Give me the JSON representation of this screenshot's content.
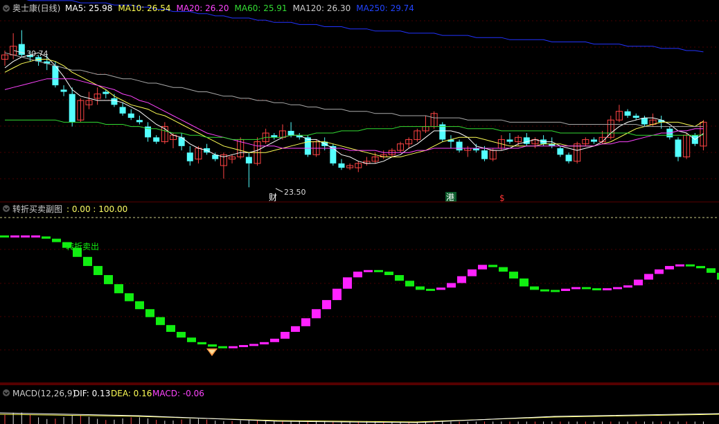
{
  "main_panel": {
    "header": {
      "stock": "奥士康(日线)",
      "ma_labels": [
        {
          "text": "MA5: 25.98",
          "color": "#ffffff"
        },
        {
          "text": "MA10: 26.54",
          "color": "#ffff55"
        },
        {
          "text": "MA20: 26.20",
          "color": "#ff44ff"
        },
        {
          "text": "MA60: 25.91",
          "color": "#33dd33"
        },
        {
          "text": "MA120: 26.30",
          "color": "#cccccc"
        },
        {
          "text": "MA250: 29.74",
          "color": "#2244ff"
        }
      ]
    },
    "high_label": "30.74",
    "low_label": "23.50",
    "markers": {
      "cai": "财",
      "gang": "港",
      "dollar": "$"
    }
  },
  "sub_panel": {
    "title": "转折买卖副图",
    "range": ": 0.00 : 100.00",
    "sell_label": "转折卖出"
  },
  "macd_panel": {
    "title": "MACD(12,26,9)",
    "dif": "DIF: 0.13",
    "dea": "DEA: 0.16",
    "macd": "MACD: -0.06"
  },
  "colors": {
    "up": "#ff4444",
    "down": "#54ffff",
    "buy": "#ff22ff",
    "sell": "#11ee11",
    "ma250": "#2233ff"
  },
  "chart_data": [
    {
      "type": "candlestick",
      "title": "奥士康(日线)",
      "ylim": [
        23.0,
        31.3
      ],
      "ohlc": [
        [
          29.4,
          29.8,
          29.1,
          29.6
        ],
        [
          29.6,
          30.6,
          29.4,
          30.0
        ],
        [
          30.1,
          30.74,
          29.5,
          29.6
        ],
        [
          29.6,
          29.8,
          29.3,
          29.5
        ],
        [
          29.5,
          29.6,
          29.1,
          29.3
        ],
        [
          29.3,
          29.6,
          28.9,
          29.2
        ],
        [
          29.1,
          29.3,
          28.1,
          28.2
        ],
        [
          28.0,
          28.2,
          27.7,
          27.9
        ],
        [
          27.8,
          28.1,
          26.3,
          26.5
        ],
        [
          26.6,
          27.6,
          26.5,
          27.5
        ],
        [
          27.3,
          27.9,
          27.1,
          27.5
        ],
        [
          27.6,
          28.1,
          27.3,
          27.8
        ],
        [
          27.9,
          28.0,
          27.6,
          27.8
        ],
        [
          27.6,
          27.8,
          27.2,
          27.3
        ],
        [
          27.2,
          27.4,
          26.8,
          26.9
        ],
        [
          26.9,
          27.1,
          26.6,
          26.7
        ],
        [
          26.6,
          26.8,
          26.4,
          26.5
        ],
        [
          26.3,
          26.5,
          25.6,
          25.8
        ],
        [
          25.8,
          25.9,
          25.5,
          25.6
        ],
        [
          25.6,
          26.5,
          25.5,
          26.3
        ],
        [
          25.7,
          26.0,
          25.3,
          25.9
        ],
        [
          25.8,
          26.0,
          25.2,
          25.4
        ],
        [
          25.1,
          25.4,
          24.5,
          24.7
        ],
        [
          24.8,
          25.4,
          24.6,
          25.3
        ],
        [
          25.3,
          25.5,
          25.0,
          25.1
        ],
        [
          25.0,
          25.1,
          24.7,
          24.8
        ],
        [
          24.5,
          25.1,
          23.9,
          25.0
        ],
        [
          24.8,
          25.0,
          24.6,
          24.9
        ],
        [
          24.9,
          25.8,
          24.8,
          25.7
        ],
        [
          24.9,
          25.1,
          23.5,
          24.6
        ],
        [
          24.6,
          25.8,
          24.5,
          25.6
        ],
        [
          25.6,
          26.2,
          25.5,
          26.0
        ],
        [
          25.9,
          26.0,
          25.7,
          25.8
        ],
        [
          25.8,
          26.4,
          25.7,
          26.1
        ],
        [
          26.1,
          26.5,
          25.8,
          25.9
        ],
        [
          25.9,
          26.0,
          25.7,
          25.8
        ],
        [
          25.8,
          25.9,
          24.9,
          25.0
        ],
        [
          25.0,
          25.7,
          24.9,
          25.6
        ],
        [
          25.6,
          25.8,
          25.2,
          25.4
        ],
        [
          25.4,
          25.5,
          24.5,
          24.6
        ],
        [
          24.6,
          24.8,
          24.3,
          24.4
        ],
        [
          24.4,
          24.6,
          24.3,
          24.5
        ],
        [
          24.4,
          24.7,
          24.2,
          24.6
        ],
        [
          24.6,
          24.9,
          24.5,
          24.7
        ],
        [
          24.7,
          25.1,
          24.6,
          24.9
        ],
        [
          24.9,
          25.2,
          24.8,
          25.0
        ],
        [
          25.0,
          25.3,
          24.9,
          25.2
        ],
        [
          25.2,
          25.6,
          25.1,
          25.5
        ],
        [
          25.5,
          25.8,
          25.3,
          25.7
        ],
        [
          25.7,
          26.2,
          25.6,
          26.1
        ],
        [
          26.1,
          26.8,
          26.0,
          26.3
        ],
        [
          26.3,
          27.0,
          26.2,
          26.9
        ],
        [
          26.4,
          26.5,
          25.6,
          25.7
        ],
        [
          25.7,
          25.9,
          25.3,
          25.6
        ],
        [
          25.6,
          25.7,
          25.1,
          25.2
        ],
        [
          25.2,
          25.4,
          24.9,
          25.3
        ],
        [
          25.3,
          25.5,
          25.1,
          25.2
        ],
        [
          25.2,
          25.4,
          24.7,
          24.8
        ],
        [
          24.8,
          25.3,
          24.7,
          25.2
        ],
        [
          25.3,
          25.9,
          25.2,
          25.7
        ],
        [
          25.7,
          26.0,
          25.5,
          25.6
        ],
        [
          25.6,
          25.9,
          25.4,
          25.8
        ],
        [
          25.8,
          26.0,
          25.4,
          25.5
        ],
        [
          25.5,
          25.8,
          25.3,
          25.7
        ],
        [
          25.7,
          25.9,
          25.4,
          25.5
        ],
        [
          25.5,
          25.8,
          25.3,
          25.4
        ],
        [
          25.3,
          25.4,
          24.9,
          25.0
        ],
        [
          25.0,
          25.1,
          24.6,
          24.7
        ],
        [
          24.7,
          25.6,
          24.6,
          25.5
        ],
        [
          25.5,
          25.8,
          25.4,
          25.7
        ],
        [
          25.7,
          25.8,
          25.5,
          25.6
        ],
        [
          25.6,
          26.1,
          25.5,
          25.8
        ],
        [
          25.8,
          26.8,
          25.7,
          26.6
        ],
        [
          26.6,
          27.3,
          26.5,
          27.0
        ],
        [
          27.0,
          27.1,
          26.7,
          26.8
        ],
        [
          26.8,
          26.9,
          26.6,
          26.7
        ],
        [
          26.7,
          26.8,
          26.3,
          26.4
        ],
        [
          26.4,
          26.9,
          26.3,
          26.6
        ],
        [
          26.6,
          26.8,
          26.2,
          26.5
        ],
        [
          26.2,
          26.3,
          25.7,
          25.8
        ],
        [
          25.7,
          25.8,
          24.7,
          24.9
        ],
        [
          24.9,
          26.0,
          24.8,
          25.9
        ],
        [
          25.9,
          26.0,
          25.4,
          25.5
        ],
        [
          25.4,
          26.6,
          25.2,
          26.5
        ]
      ],
      "ma_series": [
        {
          "name": "MA5",
          "values": [
            29.0,
            29.3,
            29.5,
            29.6,
            29.7,
            29.5,
            29.1,
            28.6,
            28.0,
            27.7,
            27.6,
            27.5,
            27.5,
            27.5,
            27.4,
            27.2,
            27.0,
            26.7,
            26.4,
            26.2,
            25.9,
            25.8,
            25.5,
            25.3,
            25.2,
            25.0,
            24.9,
            25.0,
            25.1,
            25.1,
            25.2,
            25.4,
            25.6,
            25.8,
            25.9,
            25.9,
            25.7,
            25.7,
            25.5,
            25.3,
            25.0,
            24.9,
            24.7,
            24.6,
            24.6,
            24.7,
            24.9,
            25.0,
            25.3,
            25.5,
            25.8,
            26.1,
            26.1,
            26.1,
            26.0,
            25.8,
            25.4,
            25.3,
            25.2,
            25.2,
            25.3,
            25.5,
            25.6,
            25.7,
            25.6,
            25.6,
            25.4,
            25.3,
            25.2,
            25.3,
            25.4,
            25.6,
            26.0,
            26.3,
            26.5,
            26.6,
            26.7,
            26.7,
            26.6,
            26.4,
            26.1,
            26.0,
            25.7,
            25.98
          ]
        },
        {
          "name": "MA10",
          "values": [
            28.8,
            29.0,
            29.2,
            29.3,
            29.4,
            29.4,
            29.3,
            29.1,
            28.8,
            28.6,
            28.4,
            28.2,
            28.0,
            27.7,
            27.5,
            27.3,
            27.2,
            27.1,
            26.9,
            26.8,
            26.6,
            26.4,
            26.2,
            26.0,
            25.8,
            25.6,
            25.4,
            25.3,
            25.2,
            25.1,
            25.1,
            25.1,
            25.2,
            25.3,
            25.4,
            25.5,
            25.6,
            25.6,
            25.6,
            25.5,
            25.4,
            25.3,
            25.2,
            25.1,
            25.0,
            24.9,
            24.9,
            24.9,
            25.0,
            25.1,
            25.2,
            25.4,
            25.6,
            25.7,
            25.8,
            25.8,
            25.8,
            25.7,
            25.6,
            25.5,
            25.4,
            25.4,
            25.4,
            25.4,
            25.5,
            25.5,
            25.5,
            25.4,
            25.4,
            25.4,
            25.4,
            25.5,
            25.6,
            25.8,
            26.0,
            26.2,
            26.3,
            26.4,
            26.5,
            26.5,
            26.5,
            26.4,
            26.3,
            26.54
          ]
        },
        {
          "name": "MA20",
          "values": [
            28.0,
            28.1,
            28.2,
            28.3,
            28.4,
            28.5,
            28.5,
            28.5,
            28.5,
            28.4,
            28.3,
            28.2,
            28.1,
            28.0,
            27.8,
            27.7,
            27.5,
            27.4,
            27.2,
            27.0,
            26.8,
            26.6,
            26.4,
            26.2,
            26.0,
            25.9,
            25.8,
            25.7,
            25.6,
            25.5,
            25.4,
            25.4,
            25.4,
            25.3,
            25.3,
            25.3,
            25.3,
            25.3,
            25.3,
            25.3,
            25.3,
            25.2,
            25.2,
            25.2,
            25.2,
            25.1,
            25.1,
            25.1,
            25.1,
            25.2,
            25.2,
            25.3,
            25.3,
            25.3,
            25.3,
            25.3,
            25.3,
            25.3,
            25.3,
            25.3,
            25.3,
            25.3,
            25.4,
            25.4,
            25.4,
            25.4,
            25.4,
            25.4,
            25.4,
            25.4,
            25.4,
            25.5,
            25.5,
            25.6,
            25.6,
            25.7,
            25.8,
            25.9,
            26.0,
            26.0,
            26.1,
            26.1,
            26.2,
            26.2
          ]
        },
        {
          "name": "MA60",
          "values": [
            26.6,
            26.6,
            26.6,
            26.6,
            26.6,
            26.6,
            26.6,
            26.5,
            26.5,
            26.5,
            26.5,
            26.5,
            26.4,
            26.4,
            26.4,
            26.3,
            26.3,
            26.2,
            26.2,
            26.1,
            26.0,
            26.0,
            25.9,
            25.9,
            25.8,
            25.8,
            25.8,
            25.7,
            25.7,
            25.7,
            25.7,
            25.8,
            25.8,
            25.8,
            25.9,
            25.9,
            25.9,
            26.0,
            26.0,
            26.0,
            26.1,
            26.1,
            26.1,
            26.2,
            26.2,
            26.2,
            26.2,
            26.3,
            26.3,
            26.3,
            26.3,
            26.3,
            26.3,
            26.3,
            26.3,
            26.2,
            26.2,
            26.2,
            26.2,
            26.1,
            26.1,
            26.1,
            26.1,
            26.1,
            26.1,
            26.1,
            26.0,
            26.0,
            26.0,
            26.0,
            26.0,
            26.0,
            26.0,
            26.0,
            26.0,
            25.9,
            25.9,
            25.9,
            25.9,
            25.9,
            25.9,
            25.9,
            25.9,
            25.91
          ]
        },
        {
          "name": "MA120",
          "values": [
            29.7,
            29.6,
            29.5,
            29.4,
            29.3,
            29.2,
            29.1,
            29.0,
            28.9,
            28.9,
            28.8,
            28.7,
            28.7,
            28.6,
            28.5,
            28.5,
            28.4,
            28.3,
            28.3,
            28.2,
            28.1,
            28.1,
            28.0,
            27.9,
            27.9,
            27.8,
            27.7,
            27.7,
            27.6,
            27.6,
            27.5,
            27.5,
            27.4,
            27.4,
            27.3,
            27.3,
            27.2,
            27.2,
            27.1,
            27.1,
            27.1,
            27.0,
            27.0,
            27.0,
            26.9,
            26.9,
            26.9,
            26.8,
            26.8,
            26.8,
            26.8,
            26.7,
            26.7,
            26.7,
            26.7,
            26.6,
            26.6,
            26.6,
            26.6,
            26.6,
            26.5,
            26.5,
            26.5,
            26.5,
            26.5,
            26.5,
            26.5,
            26.4,
            26.4,
            26.4,
            26.4,
            26.4,
            26.4,
            26.4,
            26.4,
            26.4,
            26.3,
            26.3,
            26.3,
            26.3,
            26.3,
            26.3,
            26.3,
            26.3
          ]
        },
        {
          "name": "MA250",
          "values": [
            32.2,
            32.2,
            32.2,
            32.1,
            32.1,
            32.1,
            32.1,
            32.1,
            32.1,
            32.0,
            32.0,
            32.0,
            32.0,
            31.9,
            31.9,
            31.9,
            31.8,
            31.8,
            31.7,
            31.7,
            31.6,
            31.6,
            31.6,
            31.5,
            31.5,
            31.4,
            31.4,
            31.3,
            31.3,
            31.3,
            31.2,
            31.2,
            31.1,
            31.1,
            31.1,
            31.0,
            31.0,
            31.0,
            30.9,
            30.9,
            30.9,
            30.8,
            30.8,
            30.8,
            30.7,
            30.7,
            30.7,
            30.7,
            30.6,
            30.6,
            30.6,
            30.6,
            30.5,
            30.5,
            30.5,
            30.5,
            30.4,
            30.4,
            30.4,
            30.4,
            30.3,
            30.3,
            30.3,
            30.3,
            30.3,
            30.2,
            30.2,
            30.2,
            30.2,
            30.2,
            30.1,
            30.1,
            30.1,
            30.1,
            30.0,
            30.0,
            30.0,
            30.0,
            29.9,
            29.9,
            29.9,
            29.8,
            29.8,
            29.74
          ]
        }
      ]
    },
    {
      "type": "bar",
      "title": "转折买卖副图",
      "ylim": [
        0,
        100
      ],
      "values": [
        98,
        98,
        98,
        98,
        96,
        93,
        88,
        80,
        72,
        64,
        56,
        48,
        41,
        34,
        27,
        20,
        14,
        9,
        5,
        3,
        1,
        0,
        1,
        2,
        3,
        5,
        8,
        14,
        19,
        26,
        34,
        42,
        52,
        62,
        67,
        68,
        67,
        64,
        59,
        54,
        51,
        51,
        53,
        57,
        63,
        69,
        73,
        71,
        67,
        61,
        54,
        51,
        50,
        50,
        52,
        53,
        52,
        51,
        52,
        53,
        55,
        60,
        65,
        69,
        72,
        73,
        72,
        70,
        66,
        60,
        55,
        54
      ]
    },
    {
      "type": "line",
      "title": "MACD(12,26,9)",
      "series": [
        {
          "name": "DIF",
          "values": [
            0.13
          ]
        },
        {
          "name": "DEA",
          "values": [
            0.16
          ]
        },
        {
          "name": "MACD",
          "values": [
            -0.06
          ]
        }
      ]
    }
  ]
}
